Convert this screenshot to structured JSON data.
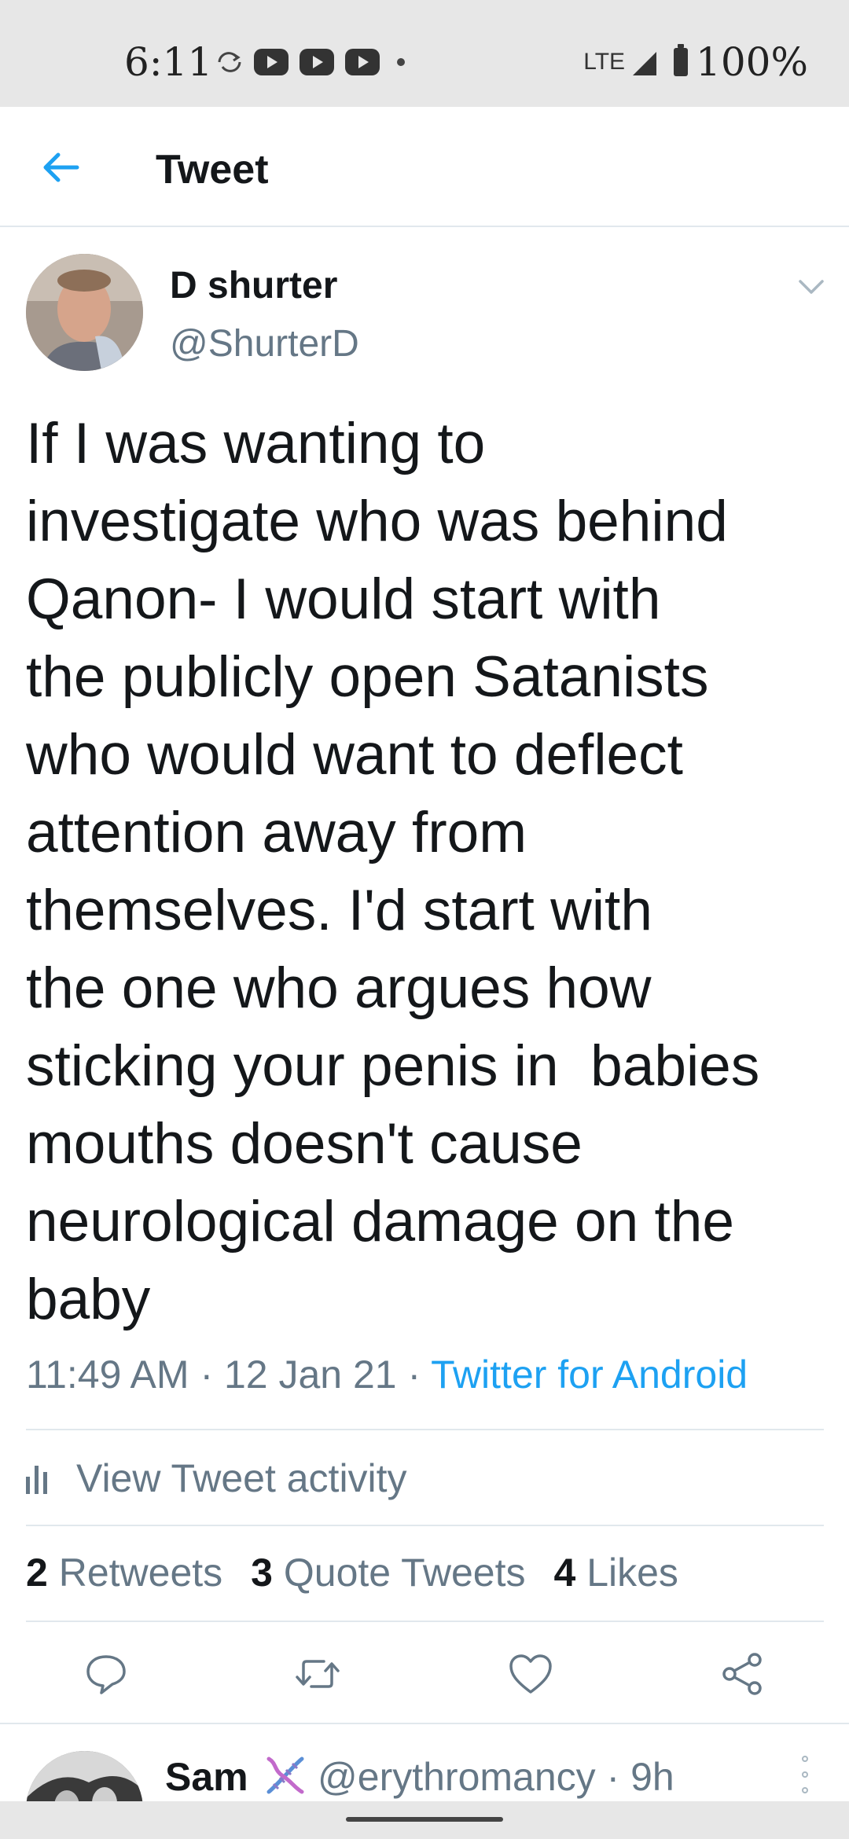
{
  "status_bar": {
    "time": "6:11",
    "network": "LTE",
    "battery": "100%",
    "notification_icons": [
      "sync-icon",
      "youtube-icon",
      "youtube-icon",
      "youtube-icon",
      "dot-icon"
    ]
  },
  "header": {
    "title": "Tweet",
    "back_icon": "arrow-left-icon"
  },
  "tweet": {
    "author_name": "D shurter",
    "author_handle": "@ShurterD",
    "text": "If I was wanting to\ninvestigate who was behind\nQanon- I would start with\nthe publicly open Satanists\nwho would want to deflect\nattention away from\nthemselves. I'd start with\nthe one who argues how\nsticking your penis in  babies\nmouths doesn't cause\nneurological damage on the\nbaby",
    "time": "11:49 AM",
    "date": "12 Jan 21",
    "separator": " · ",
    "source": "Twitter for Android",
    "activity_label": "View Tweet activity",
    "stats": {
      "retweets_count": "2",
      "retweets_label": "Retweets",
      "quotes_count": "3",
      "quotes_label": "Quote Tweets",
      "likes_count": "4",
      "likes_label": "Likes"
    }
  },
  "reply": {
    "name": "Sam",
    "emoji_icon": "dna-icon",
    "handle": "@erythromancy",
    "time": "9h"
  },
  "colors": {
    "accent": "#1da1f2",
    "secondary_text": "#657786",
    "primary_text": "#14171a",
    "divider": "#e1e8ed",
    "status_bar_bg": "#e7e7e7"
  }
}
